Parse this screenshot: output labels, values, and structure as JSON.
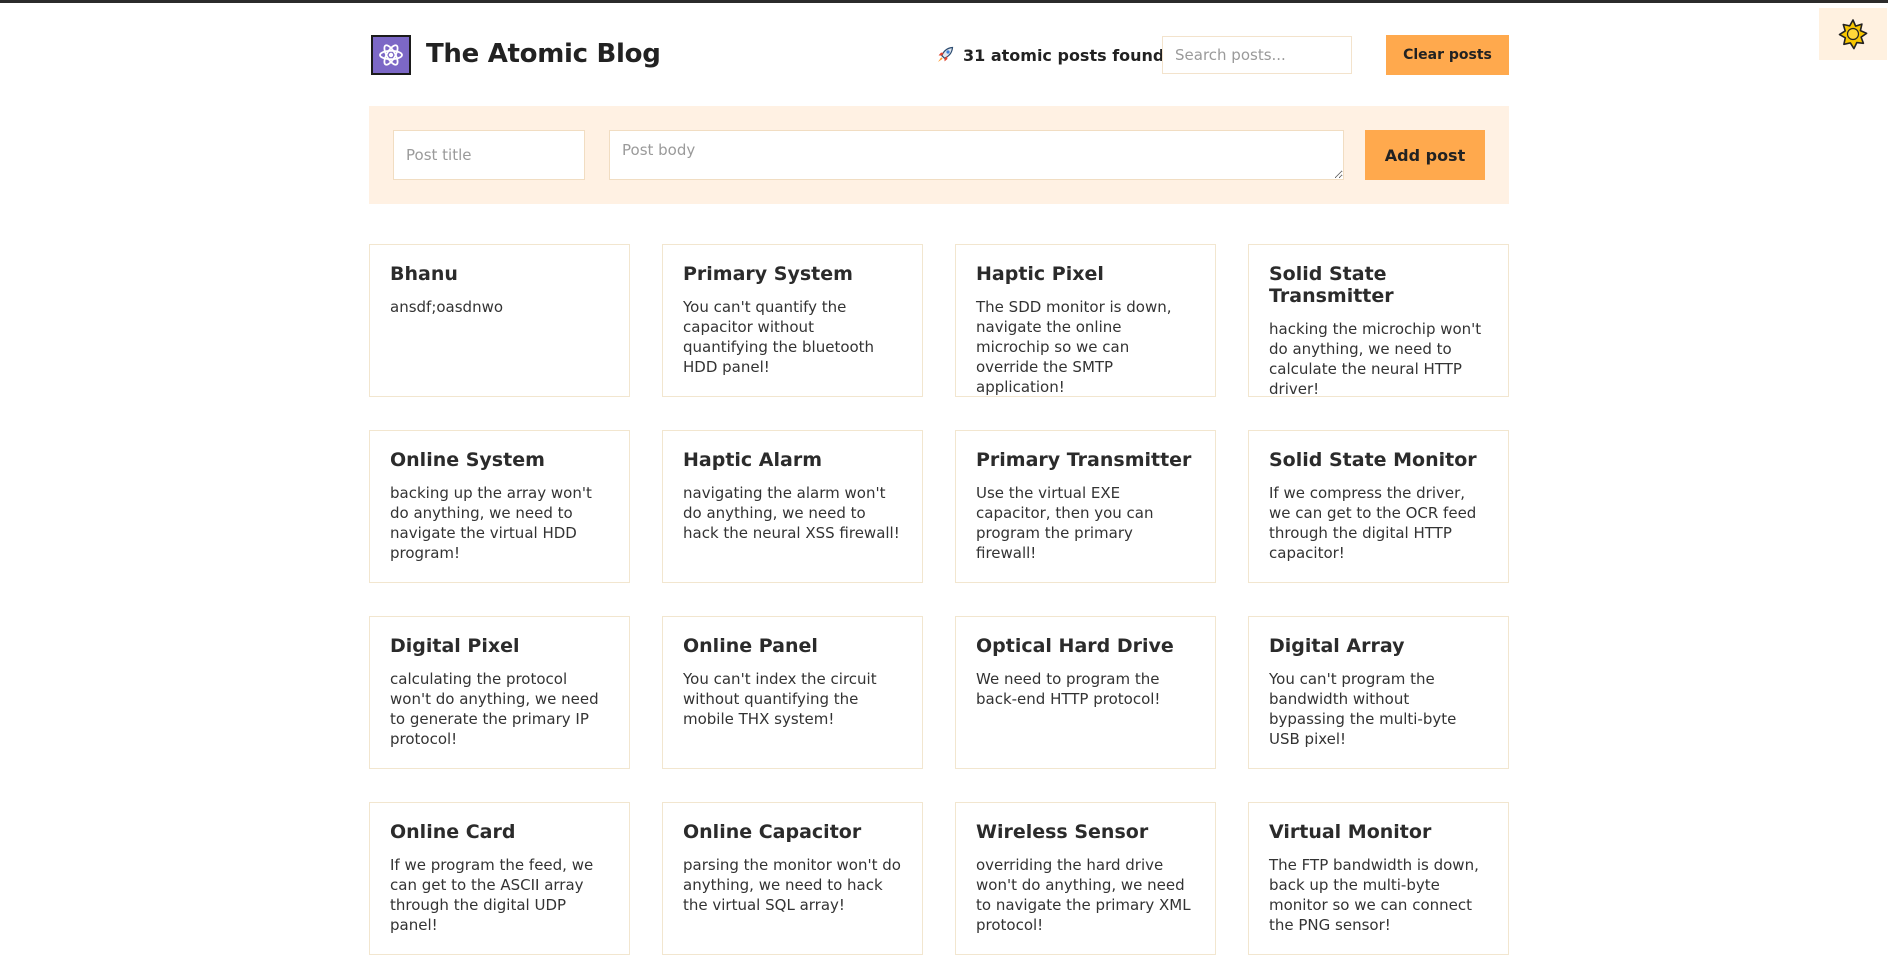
{
  "app": {
    "title": "The Atomic Blog",
    "stats": "31 atomic posts found",
    "accent_color": "#ffa94d",
    "logo_color": "#7c68c6"
  },
  "toolbar": {
    "search_placeholder": "Search posts...",
    "clear_label": "Clear posts",
    "theme_icon": "sun-icon"
  },
  "form": {
    "title_placeholder": "Post title",
    "body_placeholder": "Post body",
    "add_label": "Add post"
  },
  "posts": [
    {
      "title": "Bhanu",
      "body": "ansdf;oasdnwo"
    },
    {
      "title": "Primary System",
      "body": "You can't quantify the capacitor without quantifying the bluetooth HDD panel!"
    },
    {
      "title": "Haptic Pixel",
      "body": "The SDD monitor is down, navigate the online microchip so we can override the SMTP application!"
    },
    {
      "title": "Solid State Transmitter",
      "body": "hacking the microchip won't do anything, we need to calculate the neural HTTP driver!"
    },
    {
      "title": "Online System",
      "body": "backing up the array won't do anything, we need to navigate the virtual HDD program!"
    },
    {
      "title": "Haptic Alarm",
      "body": "navigating the alarm won't do anything, we need to hack the neural XSS firewall!"
    },
    {
      "title": "Primary Transmitter",
      "body": "Use the virtual EXE capacitor, then you can program the primary firewall!"
    },
    {
      "title": "Solid State Monitor",
      "body": "If we compress the driver, we can get to the OCR feed through the digital HTTP capacitor!"
    },
    {
      "title": "Digital Pixel",
      "body": "calculating the protocol won't do anything, we need to generate the primary IP protocol!"
    },
    {
      "title": "Online Panel",
      "body": "You can't index the circuit without quantifying the mobile THX system!"
    },
    {
      "title": "Optical Hard Drive",
      "body": "We need to program the back-end HTTP protocol!"
    },
    {
      "title": "Digital Array",
      "body": "You can't program the bandwidth without bypassing the multi-byte USB pixel!"
    },
    {
      "title": "Online Card",
      "body": "If we program the feed, we can get to the ASCII array through the digital UDP panel!"
    },
    {
      "title": "Online Capacitor",
      "body": "parsing the monitor won't do anything, we need to hack the virtual SQL array!"
    },
    {
      "title": "Wireless Sensor",
      "body": "overriding the hard drive won't do anything, we need to navigate the primary XML protocol!"
    },
    {
      "title": "Virtual Monitor",
      "body": "The FTP bandwidth is down, back up the multi-byte monitor so we can connect the PNG sensor!"
    }
  ]
}
